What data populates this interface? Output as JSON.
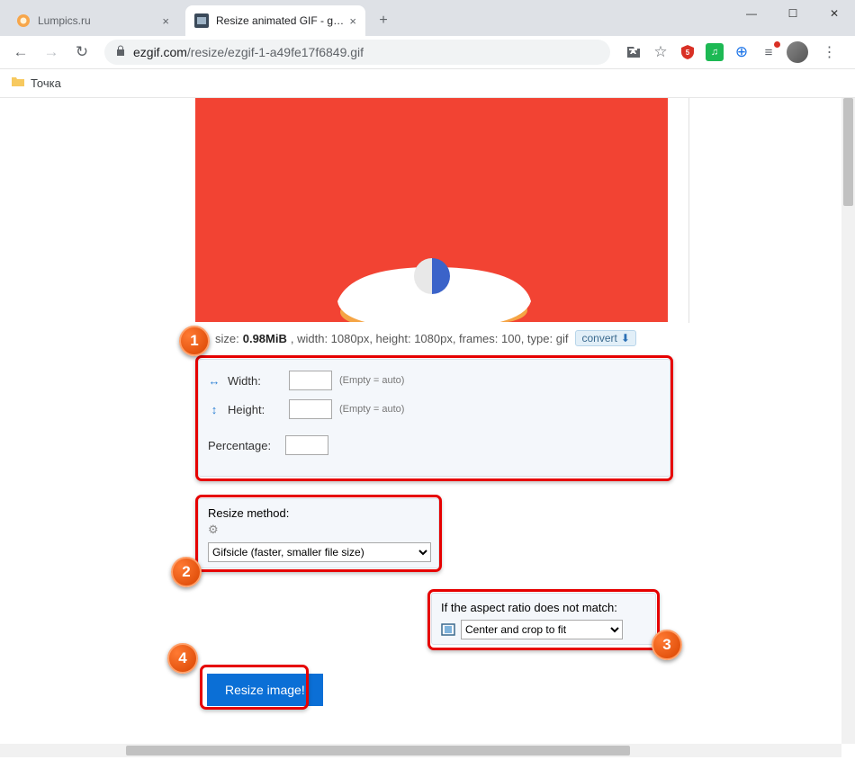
{
  "browser": {
    "tabs": [
      {
        "title": "Lumpics.ru",
        "active": false
      },
      {
        "title": "Resize animated GIF - gif-man-m",
        "active": true
      }
    ],
    "new_tab_glyph": "+",
    "win": {
      "min": "—",
      "max": "☐",
      "close": "✕"
    },
    "nav": {
      "back": "←",
      "forward": "→",
      "reload": "↻"
    },
    "url_domain": "ezgif.com",
    "url_path": "/resize/ezgif-1-a49fe17f6849.gif",
    "translate_icon": "�览",
    "star_icon": "☆",
    "ext_music": "♫",
    "ext_globe": "⊕",
    "ext_list": "≡",
    "menu": "⋮",
    "bookmark_folder": "Точка"
  },
  "info": {
    "prefix": "size: ",
    "size": "0.98MiB",
    "rest": ", width: 1080px, height: 1080px, frames: 100, type: gif",
    "convert": "convert",
    "dl_glyph": "⬇"
  },
  "form": {
    "width_label": "Width:",
    "height_label": "Height:",
    "empty_hint": "(Empty = auto)",
    "percentage_label": "Percentage:",
    "resize_method_label": "Resize method:",
    "gear": "⚙",
    "resize_method_value": "Gifsicle (faster, smaller file size)",
    "aspect_label": "If the aspect ratio does not match:",
    "aspect_value": "Center and crop to fit",
    "submit": "Resize image!"
  },
  "badges": {
    "b1": "1",
    "b2": "2",
    "b3": "3",
    "b4": "4"
  }
}
